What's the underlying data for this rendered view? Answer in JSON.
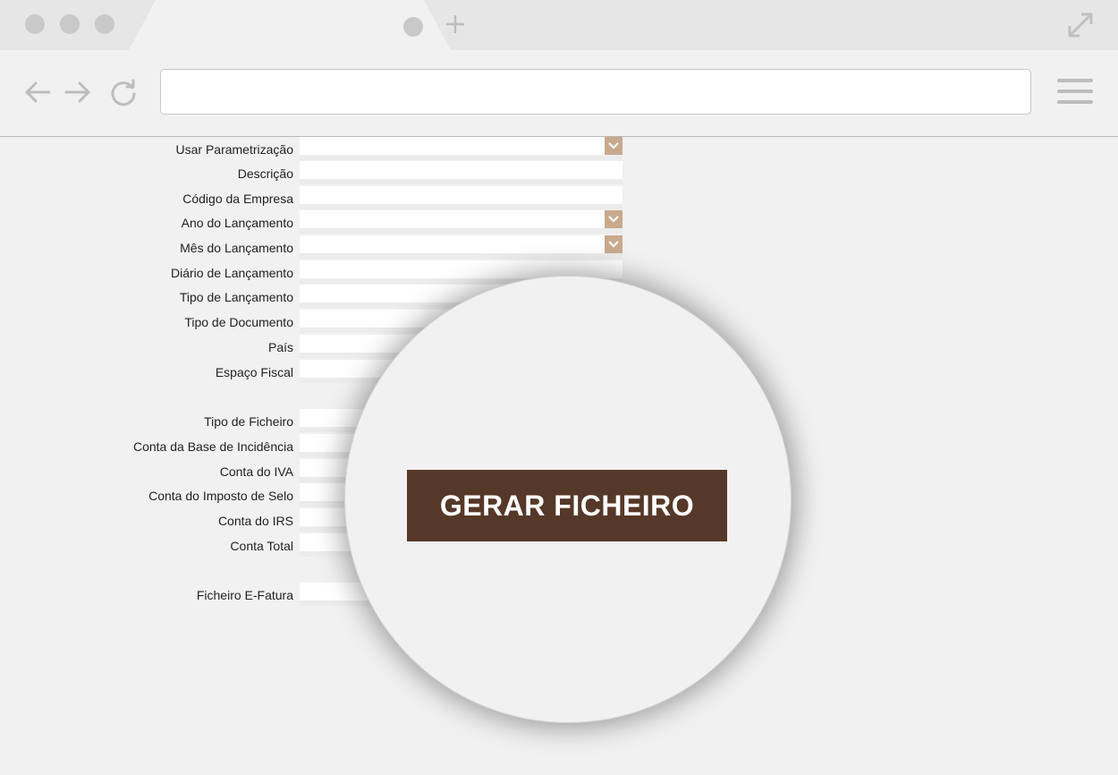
{
  "browser": {
    "address_value": "",
    "icons": [
      "plus-icon",
      "expand-icon",
      "back-arrow-icon",
      "forward-arrow-icon",
      "reload-icon",
      "hamburger-menu-icon"
    ]
  },
  "form": {
    "fields": [
      {
        "label": "Usar Parametrização",
        "type": "select"
      },
      {
        "label": "Descrição",
        "type": "text"
      },
      {
        "label": "Código da Empresa",
        "type": "text"
      },
      {
        "label": "Ano do Lançamento",
        "type": "select"
      },
      {
        "label": "Mês do Lançamento",
        "type": "select"
      },
      {
        "label": "Diário de Lançamento",
        "type": "text"
      },
      {
        "label": "Tipo de Lançamento",
        "type": "text"
      },
      {
        "label": "Tipo de Documento",
        "type": "text"
      },
      {
        "label": "País",
        "type": "text"
      },
      {
        "label": "Espaço Fiscal",
        "type": "text"
      },
      {
        "label": "Tipo de Ficheiro",
        "type": "text"
      },
      {
        "label": "Conta da Base de Incidência",
        "type": "text"
      },
      {
        "label": "Conta do IVA",
        "type": "text"
      },
      {
        "label": "Conta do Imposto de Selo",
        "type": "text"
      },
      {
        "label": "Conta do IRS",
        "type": "text"
      },
      {
        "label": "Conta Total",
        "type": "text"
      },
      {
        "label": "Ficheiro E-Fatura",
        "type": "text"
      }
    ]
  },
  "action": {
    "generate_label": "GERAR FICHEIRO"
  },
  "colors": {
    "button": "#563828",
    "select_button": "#c9a98e",
    "background": "#f1f1f1"
  }
}
